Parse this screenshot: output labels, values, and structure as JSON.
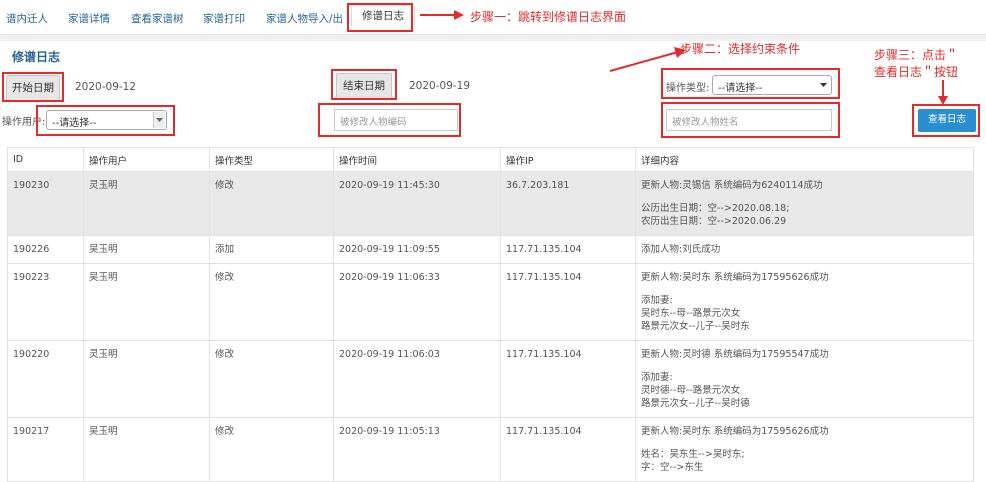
{
  "nav": {
    "tabs": [
      "谱内迁人",
      "家谱详情",
      "查看家谱树",
      "家谱打印",
      "家谱人物导入/出",
      "修谱日志"
    ],
    "active_index": 5
  },
  "annotations": {
    "step1": "步骤一：跳转到修谱日志界面",
    "step2": "步骤二：选择约束条件",
    "step3_line1": "步骤三：点击＂",
    "step3_line2": "查看日志＂按钮"
  },
  "page_title": "修谱日志",
  "filters": {
    "start_date_button": "开始日期",
    "start_date_value": "2020-09-12",
    "end_date_button": "结束日期",
    "end_date_value": "2020-09-19",
    "op_type_label": "操作类型:",
    "op_type_value": "--请选择--",
    "op_user_label": "操作用户:",
    "op_user_value": "--请选择--",
    "person_code_placeholder": "被修改人物编码",
    "person_name_placeholder": "被修改人物姓名",
    "view_log_button": "查看日志"
  },
  "table": {
    "headers": [
      "ID",
      "操作用户",
      "操作类型",
      "操作时间",
      "操作IP",
      "详细内容"
    ],
    "rows": [
      {
        "id": "190230",
        "user": "灵玉明",
        "type": "修改",
        "time": "2020-09-19 11:45:30",
        "ip": "36.7.203.181",
        "detail": [
          "更新人物:灵锡信 系统编码为6240114成功",
          "",
          "公历出生日期：空-->2020.08.18;",
          "农历出生日期：空-->2020.06.29"
        ]
      },
      {
        "id": "190226",
        "user": "吴玉明",
        "type": "添加",
        "time": "2020-09-19 11:09:55",
        "ip": "117.71.135.104",
        "detail": [
          "添加人物:刘氏成功"
        ]
      },
      {
        "id": "190223",
        "user": "吴玉明",
        "type": "修改",
        "time": "2020-09-19 11:06:33",
        "ip": "117.71.135.104",
        "detail": [
          "更新人物:吴时东 系统编码为17595626成功",
          "",
          "添加妻:",
          "吴时东--母--路景元次女",
          "路景元次女--儿子--吴时东"
        ]
      },
      {
        "id": "190220",
        "user": "灵玉明",
        "type": "修改",
        "time": "2020-09-19 11:06:03",
        "ip": "117.71.135.104",
        "detail": [
          "更新人物:灵时德 系统编码为17595547成功",
          "",
          "添加妻:",
          "灵时德--母--路景元次女",
          "路景元次女--儿子--吴时德"
        ]
      },
      {
        "id": "190217",
        "user": "吴玉明",
        "type": "修改",
        "time": "2020-09-19 11:05:13",
        "ip": "117.71.135.104",
        "detail": [
          "更新人物:吴时东 系统编码为17595626成功",
          "",
          "姓名：吴东生-->吴时东;",
          "字：空-->东生"
        ]
      }
    ]
  }
}
